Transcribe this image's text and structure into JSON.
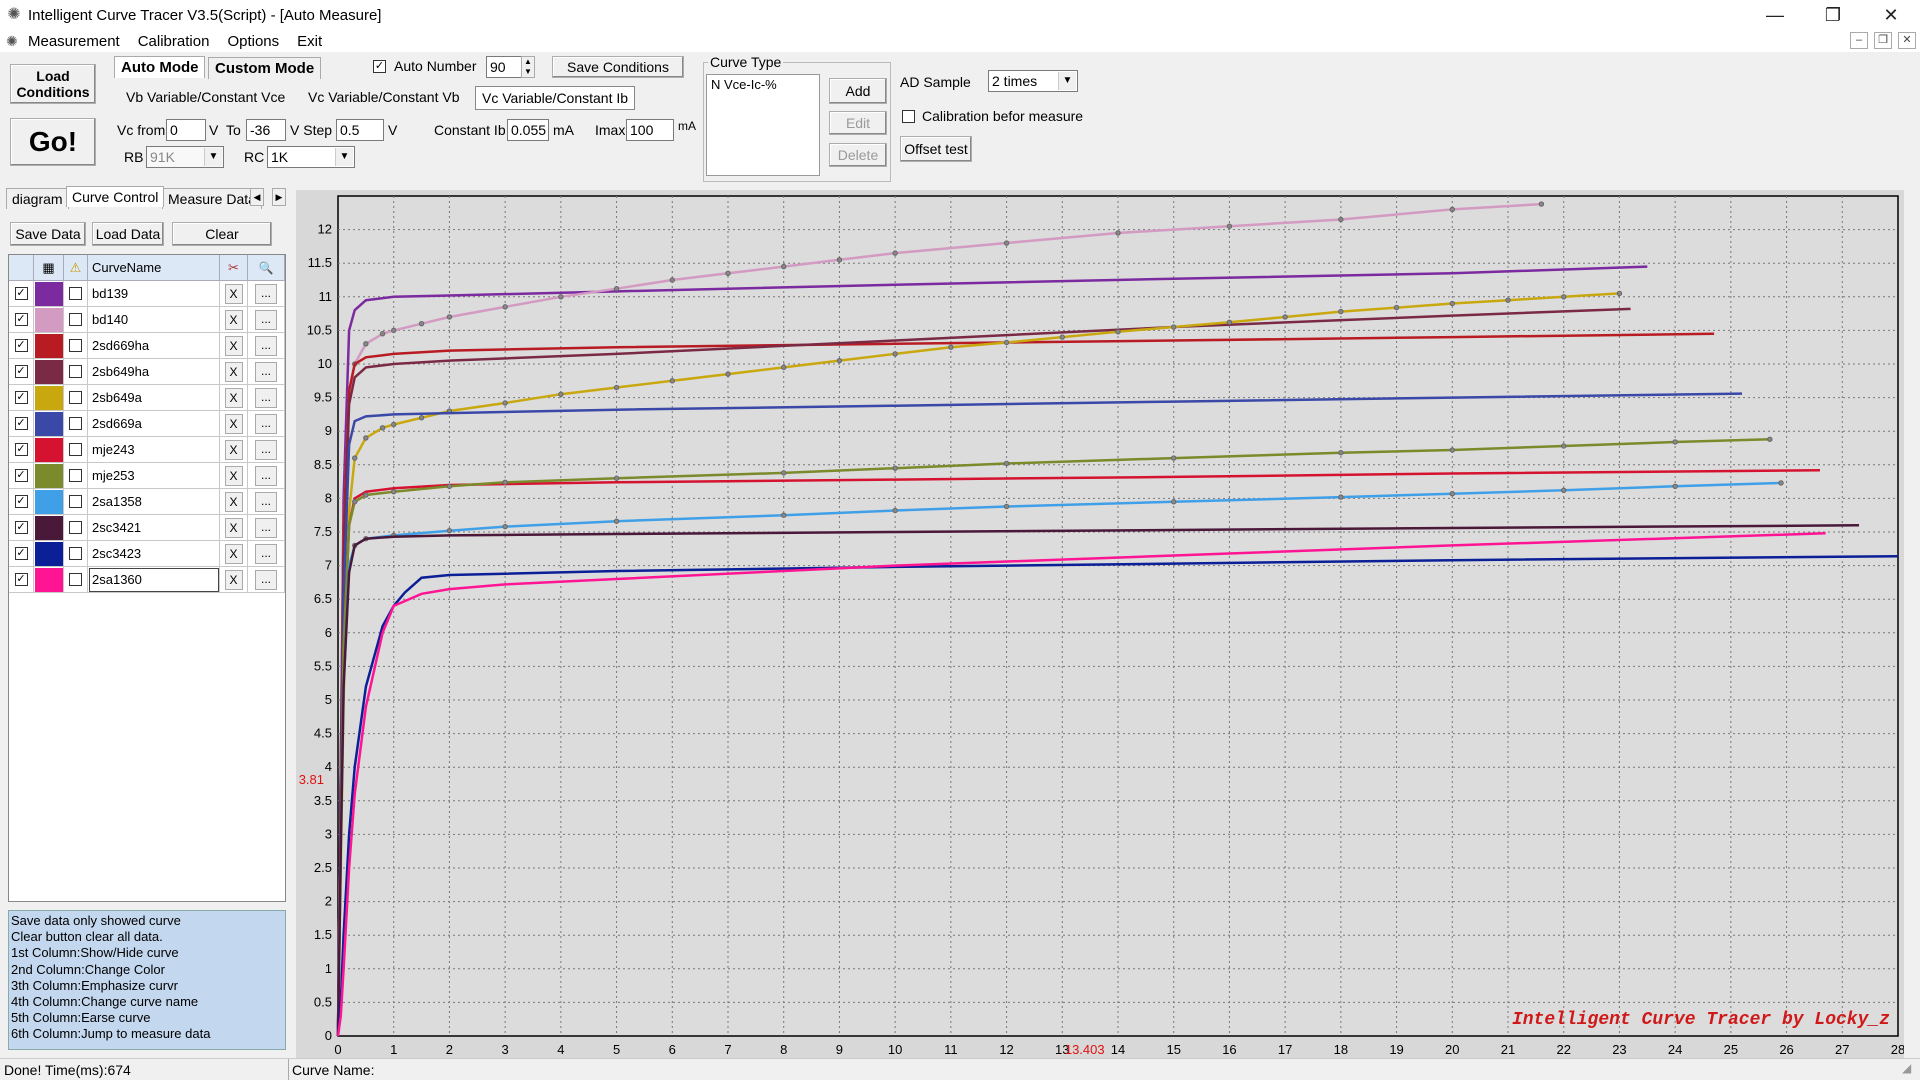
{
  "window": {
    "title": "Intelligent Curve Tracer V3.5(Script) - [Auto Measure]",
    "minimize": "—",
    "restore": "❐",
    "close": "✕"
  },
  "menu": {
    "items": [
      "Measurement",
      "Calibration",
      "Options",
      "Exit"
    ],
    "mdi_minimize": "–",
    "mdi_restore": "❐",
    "mdi_close": "✕"
  },
  "toolbar": {
    "load_conditions": "Load\nConditions",
    "go": "Go!",
    "auto_mode": "Auto Mode",
    "custom_mode": "Custom Mode",
    "auto_number_label": "Auto Number",
    "auto_number_checked": "✓",
    "auto_number_value": "90",
    "save_conditions": "Save Conditions",
    "tabs": [
      "Vb Variable/Constant Vce",
      "Vc Variable/Constant Vb",
      "Vc Variable/Constant Ib"
    ],
    "vc_from_label": "Vc from",
    "vc_from": "0",
    "v1": "V",
    "to_label": "To",
    "to_value": "-36",
    "v_step_label": "V  Step",
    "step_value": "0.5",
    "v3": "V",
    "constant_ib_label": "Constant Ib",
    "constant_ib": "0.055",
    "ma1": "mA",
    "imax_label": "Imax",
    "imax": "100",
    "ma2": "mA",
    "rb_label": "RB",
    "rb_value": "91K",
    "rc_label": "RC",
    "rc_value": "1K",
    "curve_type_title": "Curve Type",
    "curve_type_item": "N Vce-Ic-%",
    "add": "Add",
    "edit": "Edit",
    "delete": "Delete",
    "ad_sample_label": "AD Sample",
    "ad_sample_value": "2 times",
    "calibration_label": "Calibration befor measure",
    "offset_test": "Offset test"
  },
  "left_panel": {
    "tabs": [
      "diagram",
      "Curve Control",
      "Measure Data"
    ],
    "save_data": "Save Data",
    "load_data": "Load Data",
    "clear": "Clear",
    "header_name": "CurveName",
    "header_grid_icon": "▦",
    "header_warn_icon": "⚠",
    "header_erase_icon": "✂",
    "header_search_icon": "🔍",
    "x_label": "X",
    "dots_label": "...",
    "check_mark": "✓",
    "curves": [
      {
        "name": "bd139",
        "color": "#7b2aa0"
      },
      {
        "name": "bd140",
        "color": "#d39ac2"
      },
      {
        "name": "2sd669ha",
        "color": "#b81c22"
      },
      {
        "name": "2sb649ha",
        "color": "#7a2a45"
      },
      {
        "name": "2sb649a",
        "color": "#c9a80f"
      },
      {
        "name": "2sd669a",
        "color": "#3a48a8"
      },
      {
        "name": "mje243",
        "color": "#d51330"
      },
      {
        "name": "mje253",
        "color": "#7b8a2a"
      },
      {
        "name": "2sa1358",
        "color": "#3fa0e8"
      },
      {
        "name": "2sc3421",
        "color": "#4a1838"
      },
      {
        "name": "2sc3423",
        "color": "#0b1f96"
      },
      {
        "name": "2sa1360",
        "color": "#ff1493"
      }
    ],
    "help": [
      "  Save data only showed curve",
      "  Clear button clear all data.",
      "1st Column:Show/Hide curve",
      "2nd Column:Change Color",
      "3th Column:Emphasize curvr",
      "4th Column:Change curve name",
      "5th Column:Earse curve",
      "6th Column:Jump to measure data"
    ]
  },
  "status": {
    "left": "Done!  Time(ms):674",
    "right": "Curve Name:"
  },
  "chart_data": {
    "type": "line",
    "xlim": [
      0,
      28
    ],
    "ylim": [
      0,
      12.5
    ],
    "x_ticks": [
      0,
      1,
      2,
      3,
      4,
      5,
      6,
      7,
      8,
      9,
      10,
      11,
      12,
      13,
      14,
      15,
      16,
      17,
      18,
      19,
      20,
      21,
      22,
      23,
      24,
      25,
      26,
      27,
      28
    ],
    "y_ticks": [
      0,
      0.5,
      1,
      1.5,
      2,
      2.5,
      3,
      3.5,
      4,
      4.5,
      5,
      5.5,
      6,
      6.5,
      7,
      7.5,
      8,
      8.5,
      9,
      9.5,
      10,
      10.5,
      11,
      11.5,
      12
    ],
    "cursor_x": "13.403",
    "cursor_y": "3.81",
    "watermark": "Intelligent Curve Tracer by Locky_z",
    "grid": true,
    "series": [
      {
        "name": "bd139",
        "color": "#7b2aa0",
        "marker": false,
        "x": [
          0,
          0.05,
          0.1,
          0.2,
          0.3,
          0.5,
          1,
          2,
          5,
          10,
          15,
          20,
          23.5
        ],
        "y": [
          0,
          4,
          8,
          10.5,
          10.8,
          10.95,
          11.0,
          11.02,
          11.08,
          11.18,
          11.27,
          11.35,
          11.45
        ]
      },
      {
        "name": "bd140",
        "color": "#d39ac2",
        "marker": true,
        "x": [
          0,
          0.05,
          0.1,
          0.2,
          0.3,
          0.5,
          0.8,
          1,
          1.5,
          2,
          3,
          4,
          5,
          6,
          7,
          8,
          9,
          10,
          12,
          14,
          16,
          18,
          20,
          21.6
        ],
        "y": [
          0,
          4,
          7.5,
          9.6,
          10.0,
          10.3,
          10.45,
          10.5,
          10.6,
          10.7,
          10.85,
          11.0,
          11.12,
          11.25,
          11.35,
          11.45,
          11.55,
          11.65,
          11.8,
          11.95,
          12.05,
          12.15,
          12.3,
          12.38
        ]
      },
      {
        "name": "2sd669ha",
        "color": "#b81c22",
        "marker": false,
        "x": [
          0,
          0.05,
          0.1,
          0.2,
          0.3,
          0.5,
          1,
          2,
          5,
          10,
          15,
          20,
          24.7
        ],
        "y": [
          0,
          4,
          7.5,
          9.6,
          10.0,
          10.1,
          10.15,
          10.2,
          10.25,
          10.3,
          10.35,
          10.4,
          10.45
        ]
      },
      {
        "name": "2sb649ha",
        "color": "#7a2a45",
        "marker": false,
        "x": [
          0,
          0.05,
          0.1,
          0.2,
          0.3,
          0.5,
          1,
          2,
          5,
          10,
          15,
          20,
          23.2
        ],
        "y": [
          0,
          4,
          7,
          9.4,
          9.8,
          9.95,
          10.0,
          10.05,
          10.15,
          10.35,
          10.55,
          10.72,
          10.82
        ]
      },
      {
        "name": "2sb649a",
        "color": "#c9a80f",
        "marker": true,
        "x": [
          0,
          0.05,
          0.1,
          0.2,
          0.3,
          0.5,
          0.8,
          1,
          1.5,
          2,
          3,
          4,
          5,
          6,
          7,
          8,
          9,
          10,
          11,
          12,
          13,
          14,
          15,
          16,
          17,
          18,
          19,
          20,
          21,
          22,
          23
        ],
        "y": [
          0,
          2.5,
          5,
          7.8,
          8.6,
          8.9,
          9.05,
          9.1,
          9.2,
          9.3,
          9.42,
          9.55,
          9.65,
          9.75,
          9.85,
          9.95,
          10.05,
          10.15,
          10.25,
          10.32,
          10.4,
          10.48,
          10.55,
          10.62,
          10.7,
          10.78,
          10.84,
          10.9,
          10.95,
          11.0,
          11.05
        ]
      },
      {
        "name": "2sd669a",
        "color": "#3a48a8",
        "marker": false,
        "x": [
          0,
          0.05,
          0.1,
          0.2,
          0.3,
          0.5,
          1,
          2,
          5,
          10,
          15,
          20,
          25.2
        ],
        "y": [
          0,
          3.5,
          6.5,
          8.8,
          9.15,
          9.22,
          9.25,
          9.27,
          9.32,
          9.38,
          9.44,
          9.5,
          9.56
        ]
      },
      {
        "name": "mje243",
        "color": "#d51330",
        "marker": false,
        "x": [
          0,
          0.05,
          0.1,
          0.2,
          0.3,
          0.5,
          1,
          2,
          5,
          10,
          15,
          20,
          26.6
        ],
        "y": [
          0,
          3,
          5.8,
          7.6,
          8.0,
          8.1,
          8.15,
          8.2,
          8.24,
          8.28,
          8.32,
          8.37,
          8.42
        ]
      },
      {
        "name": "mje253",
        "color": "#7b8a2a",
        "marker": true,
        "x": [
          0,
          0.05,
          0.1,
          0.2,
          0.3,
          0.5,
          1,
          2,
          3,
          5,
          8,
          10,
          12,
          15,
          18,
          20,
          22,
          24,
          25.7
        ],
        "y": [
          0,
          3,
          5.8,
          7.6,
          7.95,
          8.05,
          8.1,
          8.18,
          8.24,
          8.3,
          8.38,
          8.45,
          8.52,
          8.6,
          8.68,
          8.72,
          8.78,
          8.84,
          8.88
        ]
      },
      {
        "name": "2sa1358",
        "color": "#3fa0e8",
        "marker": true,
        "x": [
          0,
          0.05,
          0.1,
          0.2,
          0.3,
          0.5,
          1,
          2,
          3,
          5,
          8,
          10,
          12,
          15,
          18,
          20,
          22,
          24,
          25.9
        ],
        "y": [
          0,
          2.8,
          5.2,
          7.0,
          7.3,
          7.4,
          7.45,
          7.52,
          7.58,
          7.66,
          7.75,
          7.82,
          7.88,
          7.95,
          8.02,
          8.07,
          8.12,
          8.18,
          8.23
        ]
      },
      {
        "name": "2sc3421",
        "color": "#4a1838",
        "marker": false,
        "x": [
          0,
          0.05,
          0.1,
          0.2,
          0.3,
          0.5,
          1,
          2,
          5,
          10,
          15,
          20,
          27.3
        ],
        "y": [
          0,
          2.8,
          5.2,
          6.9,
          7.3,
          7.4,
          7.43,
          7.45,
          7.47,
          7.5,
          7.53,
          7.56,
          7.6
        ]
      },
      {
        "name": "2sc3423",
        "color": "#0b1f96",
        "marker": false,
        "x": [
          0,
          0.05,
          0.1,
          0.2,
          0.3,
          0.5,
          0.8,
          1,
          1.2,
          1.5,
          2,
          3,
          5,
          10,
          15,
          20,
          28
        ],
        "y": [
          0,
          0.5,
          1.5,
          3.0,
          4.0,
          5.2,
          6.1,
          6.4,
          6.6,
          6.82,
          6.86,
          6.88,
          6.92,
          6.98,
          7.03,
          7.08,
          7.14
        ]
      },
      {
        "name": "2sa1360",
        "color": "#ff1493",
        "marker": false,
        "x": [
          0,
          0.05,
          0.1,
          0.2,
          0.3,
          0.5,
          0.8,
          1,
          1.5,
          2,
          3,
          5,
          8,
          10,
          15,
          20,
          26.7
        ],
        "y": [
          0,
          0.3,
          1.0,
          2.5,
          3.6,
          4.9,
          6.0,
          6.4,
          6.58,
          6.65,
          6.72,
          6.8,
          6.92,
          7.0,
          7.15,
          7.3,
          7.48
        ]
      }
    ]
  }
}
